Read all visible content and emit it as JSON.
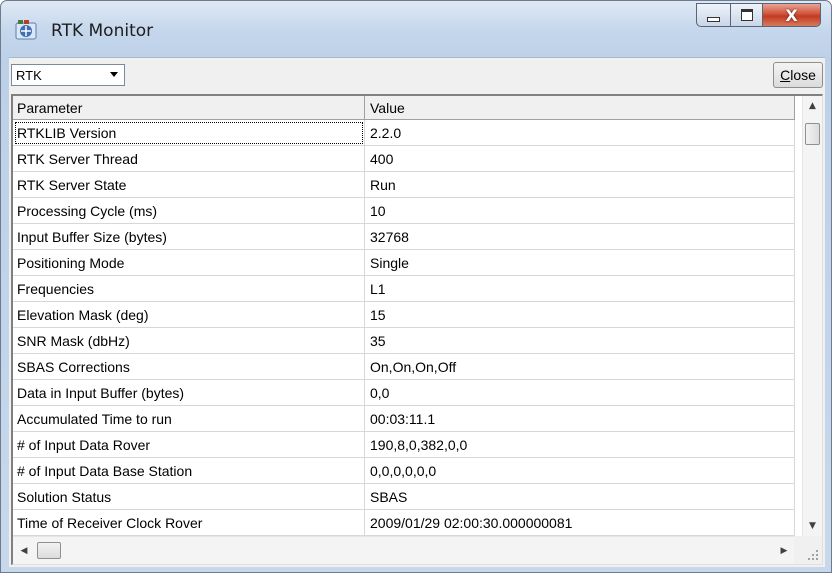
{
  "window": {
    "title": "RTK Monitor",
    "icon": "rtk-monitor-app-icon",
    "controls": {
      "minimize": "minimize-icon",
      "maximize": "maximize-icon",
      "close": "X"
    }
  },
  "toolbar": {
    "mode_select": {
      "value": "RTK",
      "icon": "dropdown-arrow-icon"
    },
    "close_button": {
      "accesskey": "C",
      "rest": "lose"
    }
  },
  "table": {
    "headers": {
      "parameter": "Parameter",
      "value": "Value"
    },
    "rows": [
      {
        "parameter": "RTKLIB Version",
        "value": "2.2.0"
      },
      {
        "parameter": "RTK Server Thread",
        "value": "400"
      },
      {
        "parameter": "RTK Server State",
        "value": "Run"
      },
      {
        "parameter": "Processing Cycle (ms)",
        "value": "10"
      },
      {
        "parameter": "Input Buffer Size (bytes)",
        "value": "32768"
      },
      {
        "parameter": "Positioning Mode",
        "value": "Single"
      },
      {
        "parameter": "Frequencies",
        "value": "L1"
      },
      {
        "parameter": "Elevation Mask (deg)",
        "value": "15"
      },
      {
        "parameter": "SNR Mask (dbHz)",
        "value": "35"
      },
      {
        "parameter": "SBAS Corrections",
        "value": "On,On,On,Off"
      },
      {
        "parameter": "Data in Input Buffer (bytes)",
        "value": "0,0"
      },
      {
        "parameter": "Accumulated Time to run",
        "value": "00:03:11.1"
      },
      {
        "parameter": "# of Input Data Rover",
        "value": "190,8,0,382,0,0"
      },
      {
        "parameter": "# of Input Data Base Station",
        "value": "0,0,0,0,0,0"
      },
      {
        "parameter": "Solution Status",
        "value": "SBAS"
      },
      {
        "parameter": "Time of Receiver Clock Rover",
        "value": "2009/01/29 02:00:30.000000081"
      }
    ]
  },
  "scrollbars": {
    "vertical": {
      "up": "scroll-up-icon",
      "down": "scroll-down-icon"
    },
    "horizontal": {
      "left": "scroll-left-icon",
      "right": "scroll-right-icon"
    }
  }
}
